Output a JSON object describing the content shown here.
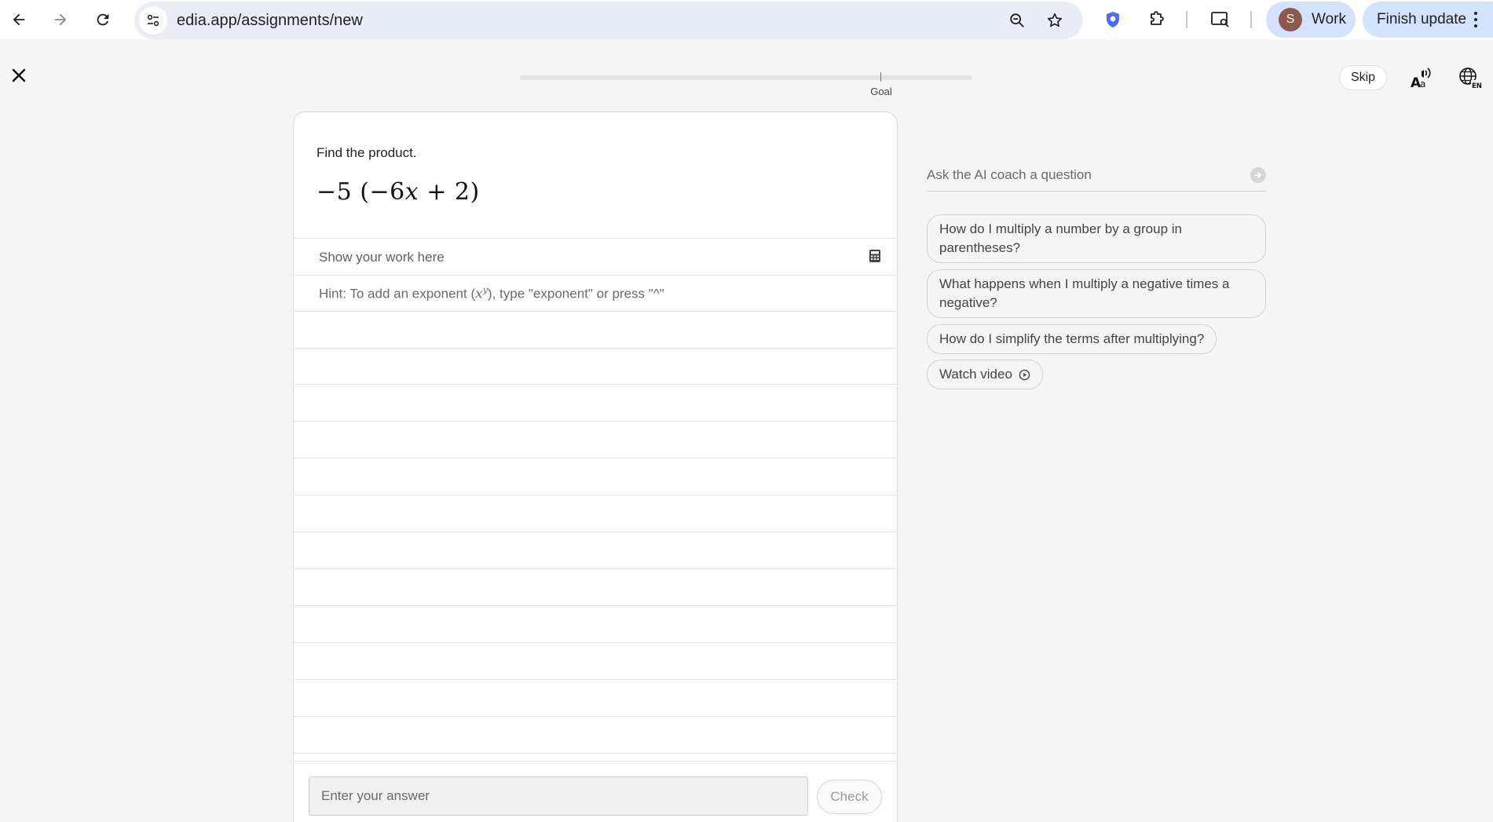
{
  "browser": {
    "url": "edia.app/assignments/new",
    "profile_initial": "S",
    "profile_label": "Work",
    "update_label": "Finish update"
  },
  "header": {
    "progress_fraction": 0,
    "goal_label": "Goal",
    "skip_label": "Skip"
  },
  "question": {
    "prompt": "Find the product.",
    "expression": {
      "coefficient": "−5",
      "open": "(",
      "inner_sign": "−6",
      "variable": "x",
      "op": "+",
      "constant": "2",
      "close": ")"
    },
    "work_label": "Show your work here",
    "hint_prefix": "Hint: To add an exponent (",
    "hint_base": "x",
    "hint_exp": "y",
    "hint_suffix": "), type \"exponent\" or press \"^\"",
    "answer_placeholder": "Enter your answer",
    "check_label": "Check"
  },
  "coach": {
    "input_placeholder": "Ask the AI coach a question",
    "suggestions": [
      "How do I multiply a number by a group in parentheses?",
      "What happens when I multiply a negative times a negative?",
      "How do I simplify the terms after multiplying?"
    ],
    "video_label": "Watch video"
  },
  "colors": {
    "omnibox": "#e9eef6",
    "profile_chip": "#d3e3fd",
    "shield": "#4a6cf7"
  }
}
